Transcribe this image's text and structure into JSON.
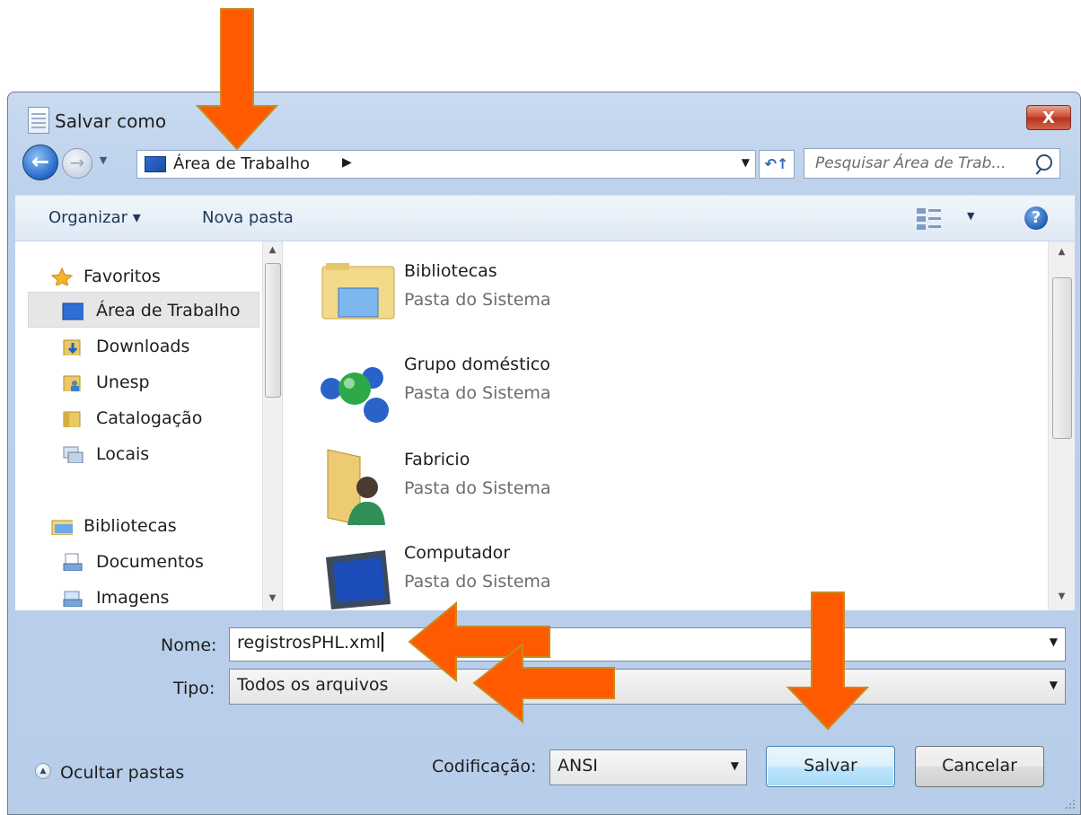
{
  "window": {
    "title": "Salvar como",
    "close_glyph": "X"
  },
  "nav": {
    "back_glyph": "←",
    "forward_glyph": "→",
    "history_glyph": "▼",
    "address_path": "Área de Trabalho",
    "address_sep": "▶",
    "address_dropdown": "▼",
    "refresh_glyph": "↶↑",
    "search_placeholder": "Pesquisar Área de Trab..."
  },
  "toolbar": {
    "organize_label": "Organizar ▾",
    "new_folder_label": "Nova pasta",
    "view_dropdown": "▼",
    "help_glyph": "?"
  },
  "sidebar": {
    "items": [
      {
        "label": "Favoritos",
        "icon": "star-icon"
      },
      {
        "label": "Área de Trabalho",
        "icon": "desktop-icon",
        "selected": true
      },
      {
        "label": "Downloads",
        "icon": "downloads-folder-icon"
      },
      {
        "label": "Unesp",
        "icon": "user-folder-icon"
      },
      {
        "label": "Catalogação",
        "icon": "folder-icon"
      },
      {
        "label": "Locais",
        "icon": "recent-places-icon"
      },
      {
        "label": "Bibliotecas",
        "icon": "libraries-icon"
      },
      {
        "label": "Documentos",
        "icon": "documents-icon"
      },
      {
        "label": "Imagens",
        "icon": "pictures-icon"
      }
    ]
  },
  "files": [
    {
      "name": "Bibliotecas",
      "type": "Pasta do Sistema",
      "icon": "libraries-folder-icon"
    },
    {
      "name": "Grupo doméstico",
      "type": "Pasta do Sistema",
      "icon": "homegroup-icon"
    },
    {
      "name": "Fabricio",
      "type": "Pasta do Sistema",
      "icon": "user-folder-icon"
    },
    {
      "name": "Computador",
      "type": "Pasta do Sistema",
      "icon": "computer-icon"
    }
  ],
  "form": {
    "name_label": "Nome:",
    "name_value": "registrosPHL.xml",
    "type_label": "Tipo:",
    "type_value": "Todos os arquivos",
    "encoding_label": "Codificação:",
    "encoding_value": "ANSI",
    "dropdown_glyph": "▼"
  },
  "footer": {
    "hide_folders_label": "Ocultar pastas",
    "hide_folders_glyph": "▲",
    "save_label": "Salvar",
    "cancel_label": "Cancelar"
  },
  "colors": {
    "window_frame": "#bcd1ec",
    "arrow_fill": "#ff5a00",
    "arrow_outline": "#c98a20"
  }
}
